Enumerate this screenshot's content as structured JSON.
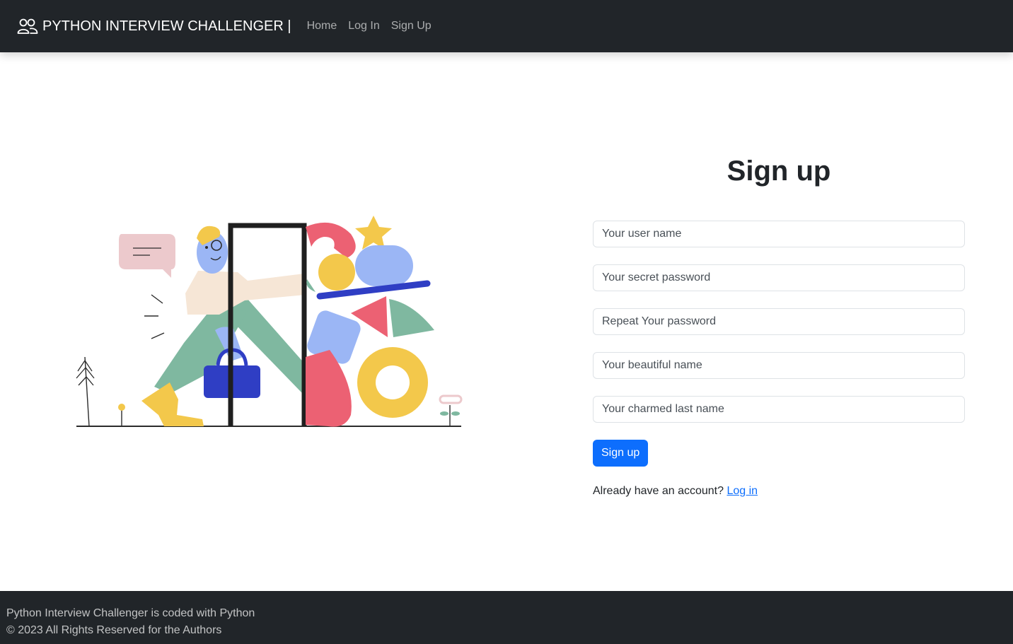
{
  "navbar": {
    "brand": "PYTHON INTERVIEW CHALLENGER |",
    "brand_icon": "users-icon",
    "links": [
      "Home",
      "Log In",
      "Sign Up"
    ]
  },
  "signup": {
    "title": "Sign up",
    "fields": {
      "username_placeholder": "Your user name",
      "password_placeholder": "Your secret password",
      "repeat_password_placeholder": "Repeat Your password",
      "first_name_placeholder": "Your beautiful name",
      "last_name_placeholder": "Your charmed last name"
    },
    "submit_label": "Sign up",
    "login_prompt": "Already have an account?",
    "login_link": "Log in"
  },
  "footer": {
    "line1": "Python Interview Challenger is coded with Python",
    "line2": "© 2023 All Rights Reserved for the Authors"
  },
  "colors": {
    "navbar_bg": "#212529",
    "primary": "#0d6efd",
    "footer_bg": "#212529"
  }
}
